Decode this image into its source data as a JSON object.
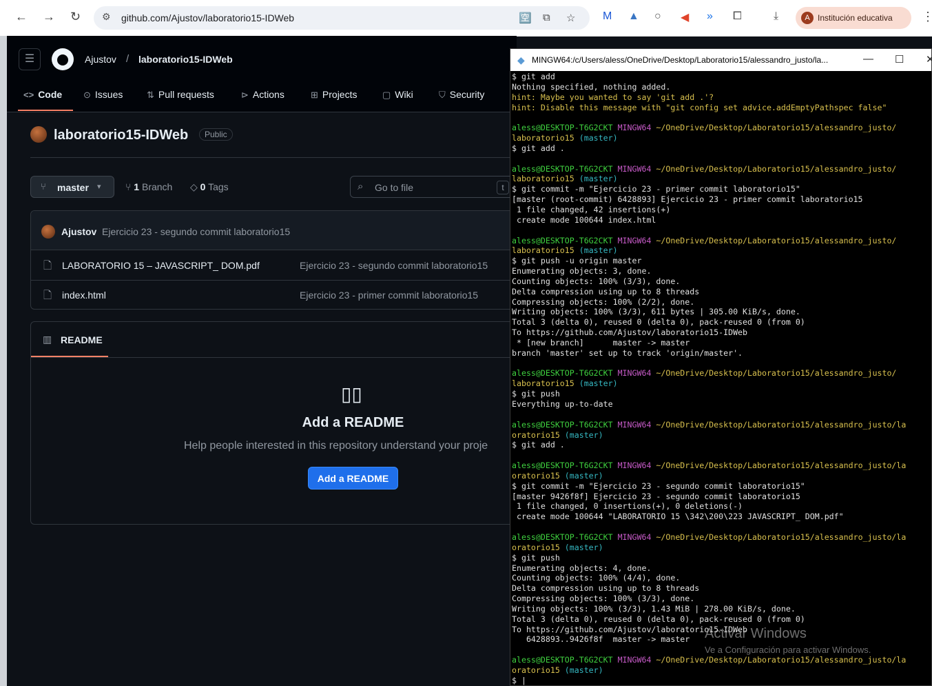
{
  "browser": {
    "url": "github.com/Ajustov/laboratorio15-IDWeb",
    "profile_label": "Institución educativa",
    "profile_initial": "A"
  },
  "github": {
    "owner": "Ajustov",
    "repo": "laboratorio15-IDWeb",
    "tabs": [
      "Code",
      "Issues",
      "Pull requests",
      "Actions",
      "Projects",
      "Wiki",
      "Security"
    ],
    "repo_title": "laboratorio15-IDWeb",
    "visibility": "Public",
    "branch": "master",
    "branch_count": "1",
    "branch_label": "Branch",
    "tag_count": "0",
    "tag_label": "Tags",
    "goto_placeholder": "Go to file",
    "goto_key": "t",
    "last_commit_author": "Ajustov",
    "last_commit_message": "Ejercicio 23 - segundo commit laboratorio15",
    "files": [
      {
        "name": "LABORATORIO 15 – JAVASCRIPT_ DOM.pdf",
        "commit": "Ejercicio 23 - segundo commit laboratorio15"
      },
      {
        "name": "index.html",
        "commit": "Ejercicio 23 - primer commit laboratorio15"
      }
    ],
    "readme_tab": "README",
    "add_title": "Add a README",
    "add_subtitle": "Help people interested in this repository understand your proje",
    "add_button": "Add a README"
  },
  "terminal": {
    "title": "MINGW64:/c/Users/aless/OneDrive/Desktop/Laboratorio15/alessandro_justo/la...",
    "lines": [
      [
        [
          "w",
          "$ git add"
        ]
      ],
      [
        [
          "w",
          "Nothing specified, nothing added."
        ]
      ],
      [
        [
          "h",
          "hint: Maybe you wanted to say 'git add .'?"
        ]
      ],
      [
        [
          "h",
          "hint: Disable this message with \"git config set advice.addEmptyPathspec false\""
        ]
      ],
      [
        [
          "w",
          ""
        ]
      ],
      [
        [
          "g",
          "aless@DESKTOP-T6G2CKT "
        ],
        [
          "m",
          "MINGW64 "
        ],
        [
          "y",
          "~/OneDrive/Desktop/Laboratorio15/alessandro_justo/"
        ]
      ],
      [
        [
          "y",
          "laboratorio15 "
        ],
        [
          "c",
          "(master)"
        ]
      ],
      [
        [
          "w",
          "$ git add ."
        ]
      ],
      [
        [
          "w",
          ""
        ]
      ],
      [
        [
          "g",
          "aless@DESKTOP-T6G2CKT "
        ],
        [
          "m",
          "MINGW64 "
        ],
        [
          "y",
          "~/OneDrive/Desktop/Laboratorio15/alessandro_justo/"
        ]
      ],
      [
        [
          "y",
          "laboratorio15 "
        ],
        [
          "c",
          "(master)"
        ]
      ],
      [
        [
          "w",
          "$ git commit -m \"Ejercicio 23 - primer commit laboratorio15\""
        ]
      ],
      [
        [
          "w",
          "[master (root-commit) 6428893] Ejercicio 23 - primer commit laboratorio15"
        ]
      ],
      [
        [
          "w",
          " 1 file changed, 42 insertions(+)"
        ]
      ],
      [
        [
          "w",
          " create mode 100644 index.html"
        ]
      ],
      [
        [
          "w",
          ""
        ]
      ],
      [
        [
          "g",
          "aless@DESKTOP-T6G2CKT "
        ],
        [
          "m",
          "MINGW64 "
        ],
        [
          "y",
          "~/OneDrive/Desktop/Laboratorio15/alessandro_justo/"
        ]
      ],
      [
        [
          "y",
          "laboratorio15 "
        ],
        [
          "c",
          "(master)"
        ]
      ],
      [
        [
          "w",
          "$ git push -u origin master"
        ]
      ],
      [
        [
          "w",
          "Enumerating objects: 3, done."
        ]
      ],
      [
        [
          "w",
          "Counting objects: 100% (3/3), done."
        ]
      ],
      [
        [
          "w",
          "Delta compression using up to 8 threads"
        ]
      ],
      [
        [
          "w",
          "Compressing objects: 100% (2/2), done."
        ]
      ],
      [
        [
          "w",
          "Writing objects: 100% (3/3), 611 bytes | 305.00 KiB/s, done."
        ]
      ],
      [
        [
          "w",
          "Total 3 (delta 0), reused 0 (delta 0), pack-reused 0 (from 0)"
        ]
      ],
      [
        [
          "w",
          "To https://github.com/Ajustov/laboratorio15-IDWeb"
        ]
      ],
      [
        [
          "w",
          " * [new branch]      master -> master"
        ]
      ],
      [
        [
          "w",
          "branch 'master' set up to track 'origin/master'."
        ]
      ],
      [
        [
          "w",
          ""
        ]
      ],
      [
        [
          "g",
          "aless@DESKTOP-T6G2CKT "
        ],
        [
          "m",
          "MINGW64 "
        ],
        [
          "y",
          "~/OneDrive/Desktop/Laboratorio15/alessandro_justo/"
        ]
      ],
      [
        [
          "y",
          "laboratorio15 "
        ],
        [
          "c",
          "(master)"
        ]
      ],
      [
        [
          "w",
          "$ git push"
        ]
      ],
      [
        [
          "w",
          "Everything up-to-date"
        ]
      ],
      [
        [
          "w",
          ""
        ]
      ],
      [
        [
          "g",
          "aless@DESKTOP-T6G2CKT "
        ],
        [
          "m",
          "MINGW64 "
        ],
        [
          "y",
          "~/OneDrive/Desktop/Laboratorio15/alessandro_justo/la"
        ]
      ],
      [
        [
          "y",
          "oratorio15 "
        ],
        [
          "c",
          "(master)"
        ]
      ],
      [
        [
          "w",
          "$ git add ."
        ]
      ],
      [
        [
          "w",
          ""
        ]
      ],
      [
        [
          "g",
          "aless@DESKTOP-T6G2CKT "
        ],
        [
          "m",
          "MINGW64 "
        ],
        [
          "y",
          "~/OneDrive/Desktop/Laboratorio15/alessandro_justo/la"
        ]
      ],
      [
        [
          "y",
          "oratorio15 "
        ],
        [
          "c",
          "(master)"
        ]
      ],
      [
        [
          "w",
          "$ git commit -m \"Ejercicio 23 - segundo commit laboratorio15\""
        ]
      ],
      [
        [
          "w",
          "[master 9426f8f] Ejercicio 23 - segundo commit laboratorio15"
        ]
      ],
      [
        [
          "w",
          " 1 file changed, 0 insertions(+), 0 deletions(-)"
        ]
      ],
      [
        [
          "w",
          " create mode 100644 \"LABORATORIO 15 \\342\\200\\223 JAVASCRIPT_ DOM.pdf\""
        ]
      ],
      [
        [
          "w",
          ""
        ]
      ],
      [
        [
          "g",
          "aless@DESKTOP-T6G2CKT "
        ],
        [
          "m",
          "MINGW64 "
        ],
        [
          "y",
          "~/OneDrive/Desktop/Laboratorio15/alessandro_justo/la"
        ]
      ],
      [
        [
          "y",
          "oratorio15 "
        ],
        [
          "c",
          "(master)"
        ]
      ],
      [
        [
          "w",
          "$ git push"
        ]
      ],
      [
        [
          "w",
          "Enumerating objects: 4, done."
        ]
      ],
      [
        [
          "w",
          "Counting objects: 100% (4/4), done."
        ]
      ],
      [
        [
          "w",
          "Delta compression using up to 8 threads"
        ]
      ],
      [
        [
          "w",
          "Compressing objects: 100% (3/3), done."
        ]
      ],
      [
        [
          "w",
          "Writing objects: 100% (3/3), 1.43 MiB | 278.00 KiB/s, done."
        ]
      ],
      [
        [
          "w",
          "Total 3 (delta 0), reused 0 (delta 0), pack-reused 0 (from 0)"
        ]
      ],
      [
        [
          "w",
          "To https://github.com/Ajustov/laboratorio15-IDWeb"
        ]
      ],
      [
        [
          "w",
          "   6428893..9426f8f  master -> master"
        ]
      ],
      [
        [
          "w",
          ""
        ]
      ],
      [
        [
          "g",
          "aless@DESKTOP-T6G2CKT "
        ],
        [
          "m",
          "MINGW64 "
        ],
        [
          "y",
          "~/OneDrive/Desktop/Laboratorio15/alessandro_justo/la"
        ]
      ],
      [
        [
          "y",
          "oratorio15 "
        ],
        [
          "c",
          "(master)"
        ]
      ],
      [
        [
          "w",
          "$ |"
        ]
      ]
    ]
  },
  "watermark": {
    "title": "Activar Windows",
    "subtitle": "Ve a Configuración para activar Windows."
  }
}
